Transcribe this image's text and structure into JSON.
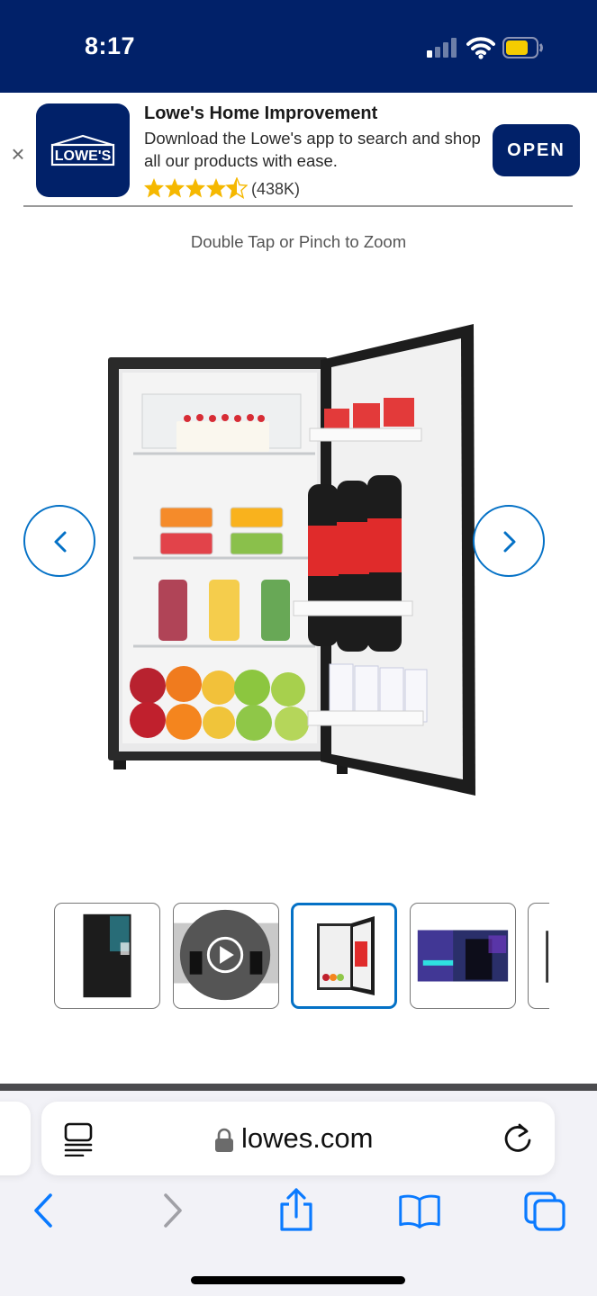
{
  "status_bar": {
    "time": "8:17"
  },
  "app_banner": {
    "close_glyph": "×",
    "app_icon_text": "LOWE'S",
    "app_name": "Lowe's Home Improvement",
    "description": "Download the Lowe's app to search and shop all our products with ease.",
    "rating_stars": 4.5,
    "rating_count": "(438K)",
    "open_label": "OPEN"
  },
  "product": {
    "zoom_hint": "Double Tap or Pinch to Zoom",
    "thumbnails": [
      {
        "name": "thumbnail-fridge-closed"
      },
      {
        "name": "thumbnail-video",
        "icon": "play-icon"
      },
      {
        "name": "thumbnail-fridge-open",
        "selected": true
      },
      {
        "name": "thumbnail-room-scene"
      },
      {
        "name": "thumbnail-partial"
      }
    ]
  },
  "browser": {
    "url": "lowes.com",
    "icons": [
      "reader-icon",
      "lock-icon",
      "reload-icon",
      "back-icon",
      "forward-icon",
      "share-icon",
      "bookmarks-icon",
      "tabs-icon"
    ]
  },
  "colors": {
    "brand_navy": "#012169",
    "link_blue": "#0471c6",
    "battery_yellow": "#f5cc00",
    "star_gold": "#f5b800"
  }
}
